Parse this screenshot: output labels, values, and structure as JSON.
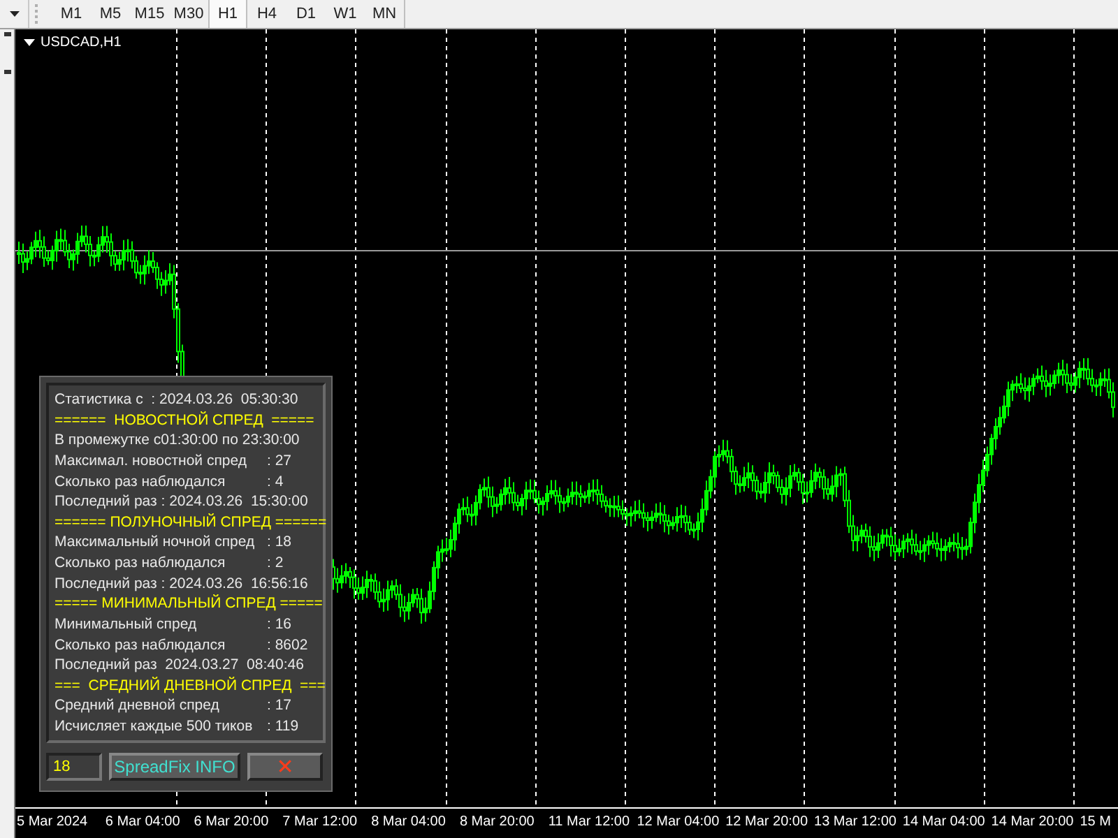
{
  "toolbar": {
    "timeframes": [
      {
        "label": "M1",
        "selected": false
      },
      {
        "label": "M5",
        "selected": false
      },
      {
        "label": "M15",
        "selected": false
      },
      {
        "label": "M30",
        "selected": false
      },
      {
        "label": "H1",
        "selected": true
      },
      {
        "label": "H4",
        "selected": false
      },
      {
        "label": "D1",
        "selected": false
      },
      {
        "label": "W1",
        "selected": false
      },
      {
        "label": "MN",
        "selected": false
      }
    ]
  },
  "chart": {
    "title": "USDCAD,H1",
    "time_labels": [
      "5 Mar 2024",
      "6 Mar 04:00",
      "6 Mar 20:00",
      "7 Mar 12:00",
      "8 Mar 04:00",
      "8 Mar 20:00",
      "11 Mar 12:00",
      "12 Mar 04:00",
      "12 Mar 20:00",
      "13 Mar 12:00",
      "14 Mar 04:00",
      "14 Mar 20:00",
      "15 M"
    ]
  },
  "panel": {
    "lines": [
      {
        "kind": "stat",
        "label": "Статистика с  : 2024.03.26  05:30:30"
      },
      {
        "kind": "header",
        "label": "======  НОВОСТНОЙ СПРЕД  ====="
      },
      {
        "kind": "stat",
        "label": "В промежутке с01:30:00 по 23:30:00"
      },
      {
        "kind": "stat",
        "label": "Максимал. новостной спред",
        "value": ": 27"
      },
      {
        "kind": "stat",
        "label": "Сколько раз наблюдался",
        "value": ": 4"
      },
      {
        "kind": "stat",
        "label": "Последний раз : 2024.03.26  15:30:00"
      },
      {
        "kind": "header",
        "label": "====== ПОЛУНОЧНЫЙ СПРЕД ======"
      },
      {
        "kind": "stat",
        "label": "Максимальный ночной спред",
        "value": ": 18"
      },
      {
        "kind": "stat",
        "label": "Сколько раз наблюдался",
        "value": ": 2"
      },
      {
        "kind": "stat",
        "label": "Последний раз : 2024.03.26  16:56:16"
      },
      {
        "kind": "header",
        "label": "===== МИНИМАЛЬНЫЙ СПРЕД ====="
      },
      {
        "kind": "stat",
        "label": "Минимальный спред",
        "value": ": 16"
      },
      {
        "kind": "stat",
        "label": "Сколько раз наблюдался",
        "value": ": 8602"
      },
      {
        "kind": "stat",
        "label": "Последний раз  2024.03.27  08:40:46"
      },
      {
        "kind": "header",
        "label": "===  СРЕДНИЙ ДНЕВНОЙ СПРЕД  ==="
      },
      {
        "kind": "stat",
        "label": "Средний дневной спред",
        "value": ": 17"
      },
      {
        "kind": "stat",
        "label": "Исчисляет каждые 500 тиков",
        "value": ": 119"
      }
    ],
    "field_value": "18",
    "info_button": "SpreadFix INFO",
    "close_button": "✕"
  }
}
